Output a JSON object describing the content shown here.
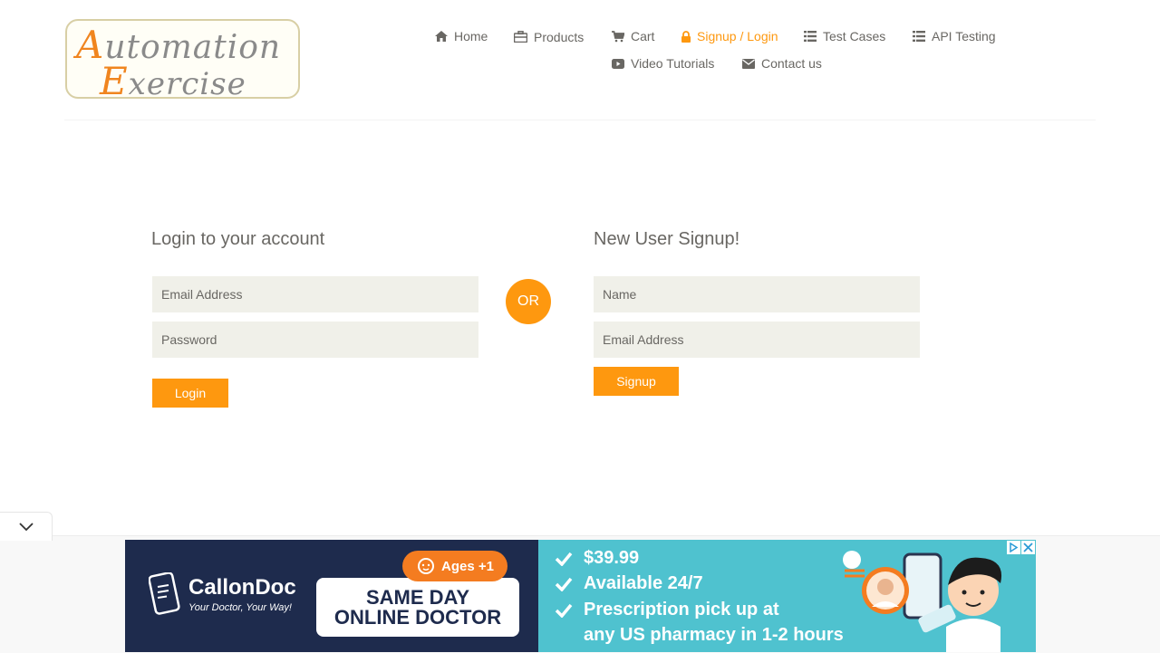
{
  "logo": {
    "line1": "Automation",
    "line2": "Exercise"
  },
  "nav": {
    "home": "Home",
    "products": "Products",
    "cart": "Cart",
    "signup_login": "Signup / Login",
    "test_cases": "Test Cases",
    "api_testing": "API Testing",
    "video_tutorials": "Video Tutorials",
    "contact_us": "Contact us",
    "active": "signup_login"
  },
  "login": {
    "title": "Login to your account",
    "email_placeholder": "Email Address",
    "password_placeholder": "Password",
    "button": "Login"
  },
  "or_label": "OR",
  "signup": {
    "title": "New User Signup!",
    "name_placeholder": "Name",
    "email_placeholder": "Email Address",
    "button": "Signup"
  },
  "ad": {
    "brand": "CallonDoc",
    "tagline": "Your Doctor, Your Way!",
    "badge": "Ages +1",
    "headline_1": "SAME DAY",
    "headline_2": "ONLINE DOCTOR",
    "points": [
      "$39.99",
      "Available 24/7",
      "Prescription pick up at",
      "any US pharmacy in 1-2 hours"
    ]
  },
  "colors": {
    "accent": "#fe980f",
    "text": "#696763",
    "field_bg": "#f0f0e9",
    "ad_navy": "#1e2b4d",
    "ad_teal": "#4fc2cf"
  }
}
